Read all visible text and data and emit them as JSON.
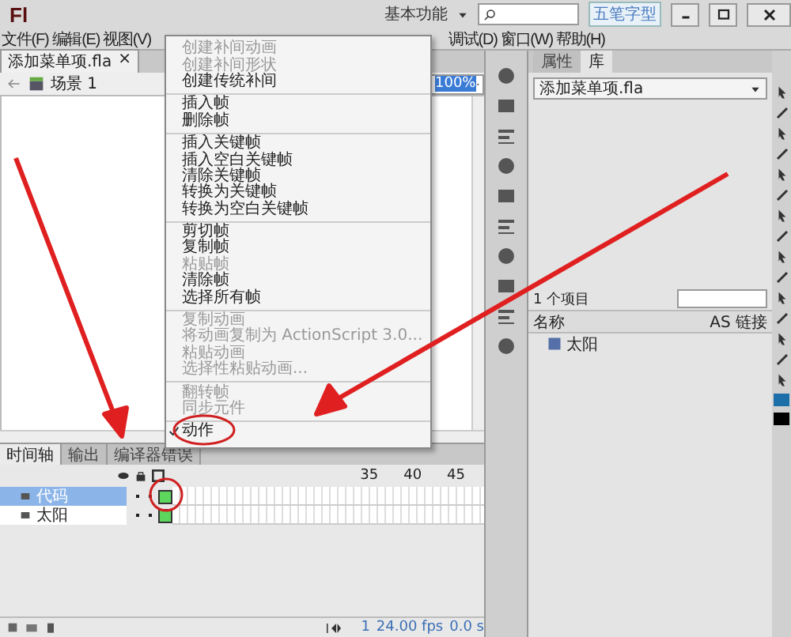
{
  "title_bar": {
    "logo": "Fl",
    "workspace": "基本功能",
    "ime": "五笔字型"
  },
  "menu_bar": {
    "left": [
      "文件(F)",
      "编辑(E)",
      "视图(V)"
    ],
    "right": [
      "调试(D)",
      "窗口(W)",
      "帮助(H)"
    ]
  },
  "document": {
    "tab": "添加菜单项.fla",
    "close": "×",
    "scene": "场景 1",
    "zoom": "100%"
  },
  "timeline": {
    "tabs": [
      {
        "label": "时间轴",
        "selected": true
      },
      {
        "label": "输出",
        "selected": false
      },
      {
        "label": "编译器错误",
        "selected": false
      }
    ],
    "layers": [
      {
        "name": "代码",
        "selected": true
      },
      {
        "name": "太阳",
        "selected": false
      }
    ],
    "frame_numbers": [
      "35",
      "40",
      "45"
    ],
    "frame": "1",
    "fps": "24.00 fps",
    "time": "0.0 s"
  },
  "library": {
    "tabs": [
      {
        "label": "属性",
        "selected": false
      },
      {
        "label": "库",
        "selected": true
      }
    ],
    "document": "添加菜单项.fla",
    "count": "1 个项目",
    "columns": [
      "名称",
      "AS 链接"
    ],
    "items": [
      {
        "name": "太阳"
      }
    ]
  },
  "context_menu": {
    "groups": [
      [
        {
          "label": "创建补间动画",
          "disabled": true,
          "checked": false
        },
        {
          "label": "创建补间形状",
          "disabled": true,
          "checked": false
        },
        {
          "label": "创建传统补间",
          "disabled": false,
          "checked": false
        }
      ],
      [
        {
          "label": "插入帧",
          "disabled": false,
          "checked": false
        },
        {
          "label": "删除帧",
          "disabled": false,
          "checked": false
        }
      ],
      [
        {
          "label": "插入关键帧",
          "disabled": false,
          "checked": false
        },
        {
          "label": "插入空白关键帧",
          "disabled": false,
          "checked": false
        },
        {
          "label": "清除关键帧",
          "disabled": false,
          "checked": false
        },
        {
          "label": "转换为关键帧",
          "disabled": false,
          "checked": false
        },
        {
          "label": "转换为空白关键帧",
          "disabled": false,
          "checked": false
        }
      ],
      [
        {
          "label": "剪切帧",
          "disabled": false,
          "checked": false
        },
        {
          "label": "复制帧",
          "disabled": false,
          "checked": false
        },
        {
          "label": "粘贴帧",
          "disabled": true,
          "checked": false
        },
        {
          "label": "清除帧",
          "disabled": false,
          "checked": false
        },
        {
          "label": "选择所有帧",
          "disabled": false,
          "checked": false
        }
      ],
      [
        {
          "label": "复制动画",
          "disabled": true,
          "checked": false
        },
        {
          "label": "将动画复制为 ActionScript 3.0...",
          "disabled": true,
          "checked": false
        },
        {
          "label": "粘贴动画",
          "disabled": true,
          "checked": false
        },
        {
          "label": "选择性粘贴动画...",
          "disabled": true,
          "checked": false
        }
      ],
      [
        {
          "label": "翻转帧",
          "disabled": true,
          "checked": false
        },
        {
          "label": "同步元件",
          "disabled": true,
          "checked": false
        }
      ],
      [
        {
          "label": "动作",
          "disabled": false,
          "checked": true
        }
      ]
    ]
  }
}
